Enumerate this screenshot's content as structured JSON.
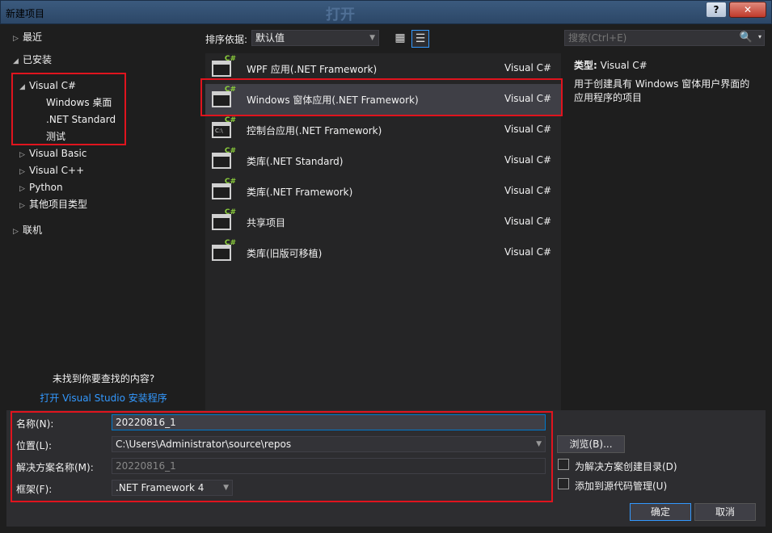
{
  "window": {
    "title": "新建项目",
    "ghost_title": "打开",
    "help_label": "?",
    "close_label": "✕"
  },
  "tree": {
    "items": [
      {
        "label": "最近",
        "arrow": "▷"
      },
      {
        "label": "已安装",
        "arrow": "◢"
      },
      {
        "label": "Visual C#",
        "arrow": "◢"
      },
      {
        "label": "Windows 桌面",
        "arrow": ""
      },
      {
        "label": ".NET Standard",
        "arrow": ""
      },
      {
        "label": "测试",
        "arrow": ""
      },
      {
        "label": "Visual Basic",
        "arrow": "▷"
      },
      {
        "label": "Visual C++",
        "arrow": "▷"
      },
      {
        "label": "Python",
        "arrow": "▷"
      },
      {
        "label": "其他项目类型",
        "arrow": "▷"
      },
      {
        "label": "联机",
        "arrow": "▷"
      }
    ],
    "not_found": "未找到你要查找的内容?",
    "installer_link": "打开 Visual Studio 安装程序"
  },
  "toolbar": {
    "sort_label": "排序依据:",
    "sort_value": "默认值",
    "grid_view_icon": "▦",
    "list_view_icon": "☰"
  },
  "templates": [
    {
      "name": "WPF 应用(.NET Framework)",
      "lang": "Visual C#",
      "icon": "window-csharp-icon"
    },
    {
      "name": "Windows 窗体应用(.NET Framework)",
      "lang": "Visual C#",
      "icon": "window-csharp-icon"
    },
    {
      "name": "控制台应用(.NET Framework)",
      "lang": "Visual C#",
      "icon": "console-csharp-icon",
      "inner": "C:\\"
    },
    {
      "name": "类库(.NET Standard)",
      "lang": "Visual C#",
      "icon": "library-csharp-icon"
    },
    {
      "name": "类库(.NET Framework)",
      "lang": "Visual C#",
      "icon": "library-csharp-icon"
    },
    {
      "name": "共享项目",
      "lang": "Visual C#",
      "icon": "shared-csharp-icon"
    },
    {
      "name": "类库(旧版可移植)",
      "lang": "Visual C#",
      "icon": "library-csharp-icon"
    }
  ],
  "search": {
    "placeholder": "搜索(Ctrl+E)",
    "icon": "🔍",
    "dropdown": "▾"
  },
  "info": {
    "type_label": "类型:",
    "type_value": "Visual C#",
    "description": "用于创建具有 Windows 窗体用户界面的应用程序的项目"
  },
  "form": {
    "name_label": "名称(N):",
    "name_value": "20220816_1",
    "location_label": "位置(L):",
    "location_value": "C:\\Users\\Administrator\\source\\repos",
    "solution_label": "解决方案名称(M):",
    "solution_value": "20220816_1",
    "framework_label": "框架(F):",
    "framework_value": ".NET Framework 4",
    "browse_label": "浏览(B)...",
    "create_dir_label": "为解决方案创建目录(D)",
    "source_control_label": "添加到源代码管理(U)",
    "ok_label": "确定",
    "cancel_label": "取消"
  },
  "colors": {
    "highlight": "#e0141e",
    "background": "#1e1e1e",
    "selection": "#3f3f46",
    "link": "#3399ff"
  }
}
